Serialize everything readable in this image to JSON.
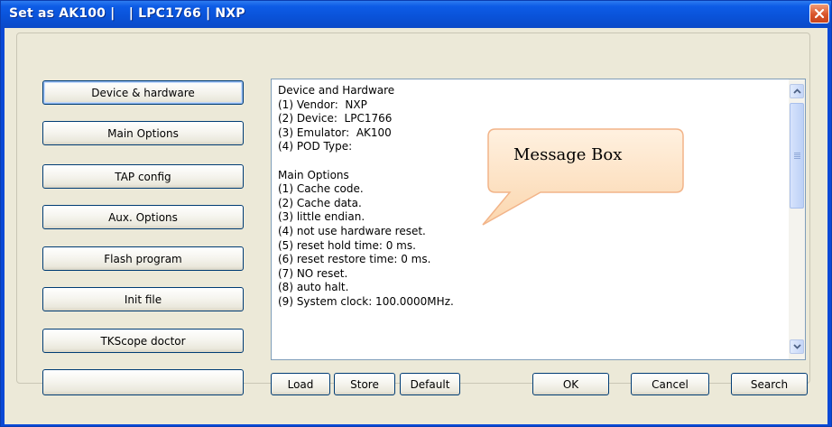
{
  "window": {
    "title": "Set as AK100 |   | LPC1766 | NXP"
  },
  "sidebar": {
    "buttons": [
      {
        "label": "Device & hardware"
      },
      {
        "label": "Main Options"
      },
      {
        "label": "TAP config"
      },
      {
        "label": "Aux. Options"
      },
      {
        "label": "Flash program"
      },
      {
        "label": "Init file"
      },
      {
        "label": "TKScope doctor"
      },
      {
        "label": ""
      }
    ]
  },
  "message_box": {
    "lines": [
      "Device and Hardware",
      "(1) Vendor:  NXP",
      "(2) Device:  LPC1766",
      "(3) Emulator:  AK100",
      "(4) POD Type:",
      "",
      "Main Options",
      "(1) Cache code.",
      "(2) Cache data.",
      "(3) little endian.",
      "(4) not use hardware reset.",
      "(5) reset hold time: 0 ms.",
      "(6) reset restore time: 0 ms.",
      "(7) NO reset.",
      "(8) auto halt.",
      "(9) System clock: 100.0000MHz."
    ]
  },
  "callout": {
    "label": "Message Box"
  },
  "bottom_buttons": {
    "load": "Load",
    "store": "Store",
    "default": "Default",
    "ok": "OK",
    "cancel": "Cancel",
    "search": "Search"
  },
  "colors": {
    "titlebar": "#0a52d8",
    "dialog_face": "#ece9d8",
    "close_button": "#d9552b",
    "callout_fill": "#fde4c8",
    "button_border": "#003c74"
  }
}
